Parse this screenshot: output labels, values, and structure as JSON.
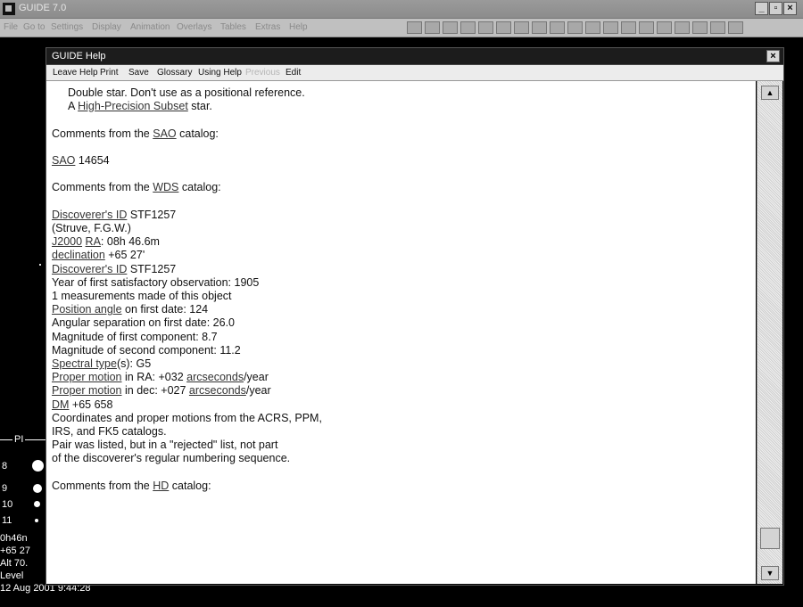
{
  "app": {
    "title": "GUIDE 7.0",
    "window_buttons": [
      "_",
      "▫",
      "×"
    ],
    "menus": [
      "File",
      "Go to",
      "Settings",
      "Display",
      "Animation",
      "Overlays",
      "Tables",
      "Extras",
      "Help"
    ]
  },
  "background": {
    "legend_header": "PI",
    "legend_magnitudes": [
      "8",
      "9",
      "10",
      "11"
    ],
    "status_lines": [
      "0h46n",
      "+65 27",
      "Alt 70.",
      "Level",
      "12 Aug 2001  9:44:28"
    ]
  },
  "help_window": {
    "title": "GUIDE Help",
    "close_label": "×",
    "menus": [
      "Leave Help",
      "Print",
      "Save",
      "Glossary",
      "Using Help",
      "Previous",
      "Edit"
    ],
    "disabled_menu": "Previous",
    "lines": {
      "l1": "Double star.  Don't use as a positional reference.",
      "l2_pre": "A ",
      "l2_link": "High-Precision Subset",
      "l2_post": " star.",
      "l3_pre": "Comments from the ",
      "l3_link": "SAO",
      "l3_post": " catalog:",
      "l4_link": "SAO",
      "l4_post": " 14654",
      "l5_pre": "Comments from the ",
      "l5_link": "WDS",
      "l5_post": " catalog:",
      "l6_link": "Discoverer's ID",
      "l6_post": " STF1257",
      "l7": "(Struve, F.G.W.)",
      "l8_link1": "J2000",
      "l8_link2": "RA",
      "l8_post": ": 08h 46.6m",
      "l9_link": "declination",
      "l9_post": " +65 27'",
      "l10_link": "Discoverer's ID",
      "l10_post": " STF1257",
      "l11": "Year of first satisfactory observation: 1905",
      "l12": "1 measurements made of this object",
      "l13_link": "Position angle",
      "l13_post": " on first date: 124",
      "l14": "Angular separation on first date: 26.0",
      "l15": "Magnitude of first component: 8.7",
      "l16": "Magnitude of second component: 11.2",
      "l17_link": "Spectral type",
      "l17_post": "(s): G5",
      "l18_link": "Proper motion",
      "l18_mid": " in RA: +032 ",
      "l18_link2": "arcseconds",
      "l18_post": "/year",
      "l19_link": "Proper motion",
      "l19_mid": " in dec: +027 ",
      "l19_link2": "arcseconds",
      "l19_post": "/year",
      "l20_link": "DM",
      "l20_post": " +65  658",
      "l21": "Coordinates and proper motions from the ACRS, PPM,",
      "l22": "IRS, and FK5 catalogs.",
      "l23": "Pair was listed, but in a \"rejected\" list, not part",
      "l24": "of the discoverer's regular numbering sequence.",
      "l25_pre": "Comments from the ",
      "l25_link": "HD",
      "l25_post": " catalog:"
    },
    "scroll_up": "▲",
    "scroll_down": "▼"
  }
}
